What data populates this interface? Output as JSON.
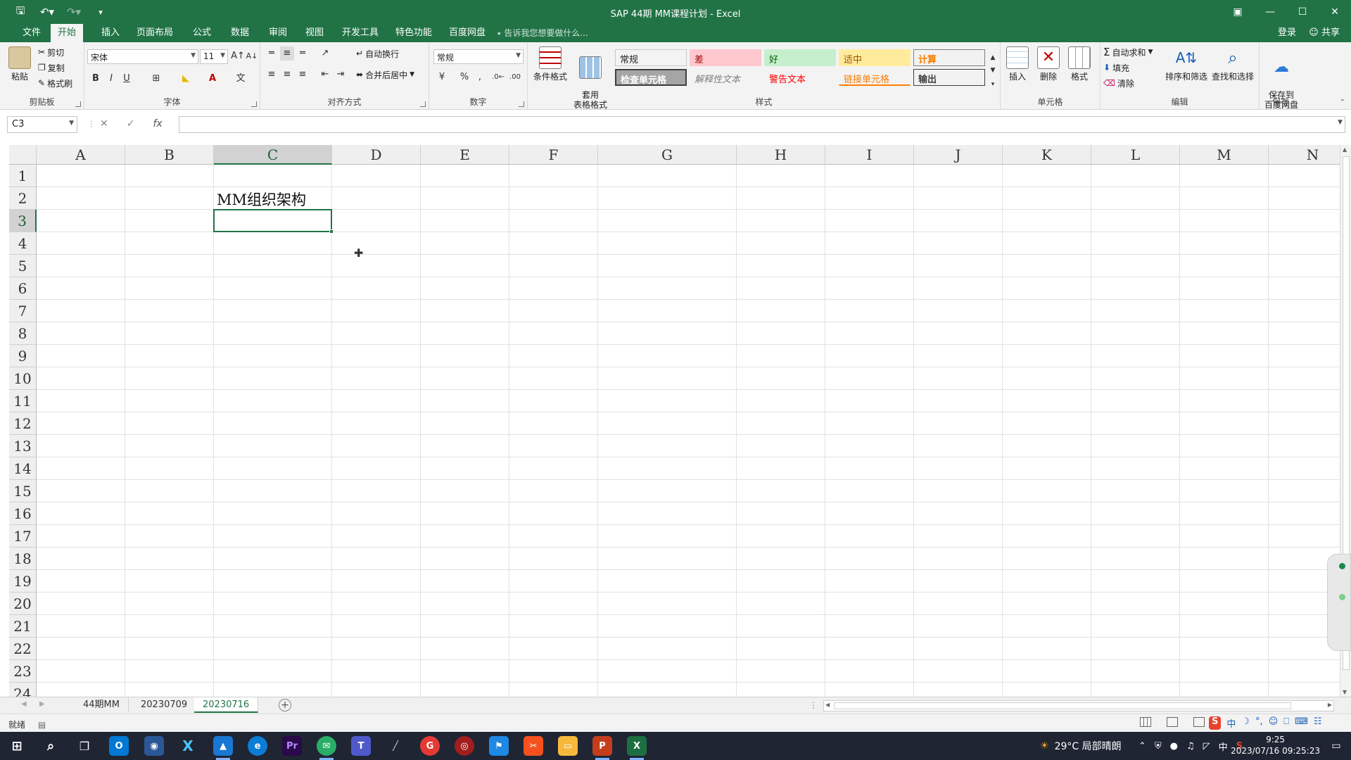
{
  "window": {
    "title": "SAP 44期 MM课程计划 - Excel"
  },
  "ribbon_tabs": [
    "文件",
    "开始",
    "插入",
    "页面布局",
    "公式",
    "数据",
    "审阅",
    "视图",
    "开发工具",
    "特色功能",
    "百度网盘"
  ],
  "active_tab": "开始",
  "tell_me": "告诉我您想要做什么...",
  "account": {
    "login": "登录",
    "share": "共享"
  },
  "clipboard": {
    "paste": "粘贴",
    "cut": "剪切",
    "copy": "复制",
    "format_painter": "格式刷",
    "label": "剪贴板"
  },
  "font": {
    "name": "宋体",
    "size": "11",
    "label": "字体"
  },
  "alignment": {
    "wrap": "自动换行",
    "merge": "合并后居中",
    "label": "对齐方式"
  },
  "number": {
    "format": "常规",
    "label": "数字"
  },
  "styles": {
    "conditional": "条件格式",
    "table": "套用\n表格格式",
    "cells": [
      {
        "text": "常规",
        "bg": "#ffffff",
        "fg": "#000000"
      },
      {
        "text": "差",
        "bg": "#ffc7ce",
        "fg": "#9c0006"
      },
      {
        "text": "好",
        "bg": "#c6efce",
        "fg": "#006100"
      },
      {
        "text": "适中",
        "bg": "#ffeb9c",
        "fg": "#9c5700"
      },
      {
        "text": "计算",
        "bg": "#f2f2f2",
        "fg": "#fa7d00"
      },
      {
        "text": "检查单元格",
        "bg": "#a5a5a5",
        "fg": "#ffffff"
      },
      {
        "text": "解释性文本",
        "bg": "#ffffff",
        "fg": "#7f7f7f"
      },
      {
        "text": "警告文本",
        "bg": "#ffffff",
        "fg": "#ff0000"
      },
      {
        "text": "链接单元格",
        "bg": "#ffffff",
        "fg": "#fa7d00"
      },
      {
        "text": "输出",
        "bg": "#f2f2f2",
        "fg": "#3f3f3f"
      }
    ],
    "label": "样式"
  },
  "cells_group": {
    "insert": "插入",
    "delete": "删除",
    "format": "格式",
    "label": "单元格"
  },
  "editing": {
    "autosum": "自动求和",
    "fill": "填充",
    "clear": "清除",
    "sort": "排序和筛选",
    "find": "查找和选择",
    "label": "编辑"
  },
  "save_group": {
    "save_baidu": "保存到\n百度网盘",
    "label": "保存"
  },
  "formula_bar": {
    "name_box": "C3",
    "formula": ""
  },
  "columns": [
    "A",
    "B",
    "C",
    "D",
    "E",
    "F",
    "G",
    "H",
    "I",
    "J",
    "K",
    "L",
    "M",
    "N"
  ],
  "rows": [
    "1",
    "2",
    "3",
    "4",
    "5",
    "6",
    "7",
    "8",
    "9",
    "10",
    "11",
    "12",
    "13",
    "14",
    "15",
    "16",
    "17",
    "18",
    "19",
    "20",
    "21",
    "22",
    "23",
    "24"
  ],
  "cell_content": {
    "C2": "MM组织架构"
  },
  "selected_cell": "C3",
  "sheets": [
    "44期MM",
    "20230709",
    "20230716"
  ],
  "active_sheet": "20230716",
  "status": {
    "ready": "就绪"
  },
  "taskbar": {
    "weather": "29°C  局部晴朗",
    "ime": "中",
    "time": "9:25",
    "date": "2023/07/16 09:25:23"
  }
}
